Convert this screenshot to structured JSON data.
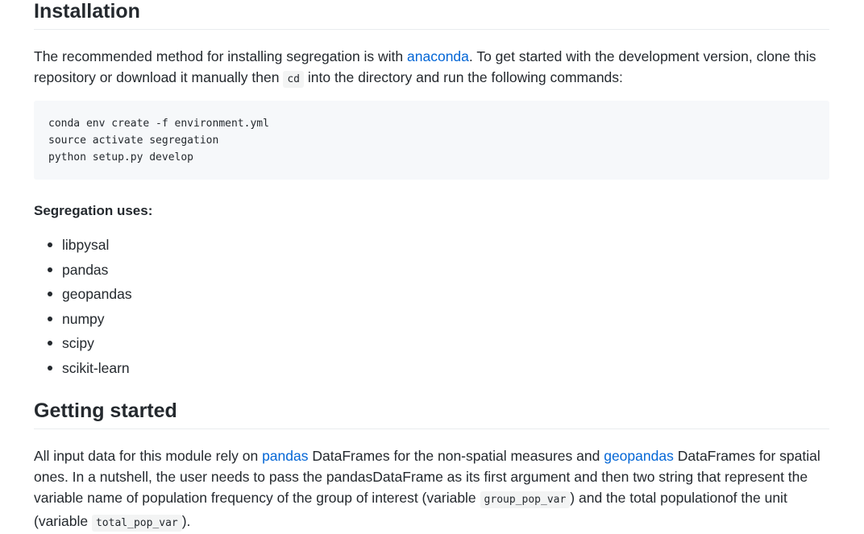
{
  "installation": {
    "heading": "Installation",
    "para": {
      "t1": "The recommended method for installing segregation is with ",
      "link": "anaconda",
      "t2": ". To get started with the development version, clone this repository or download it manually then ",
      "code": "cd",
      "t3": " into the directory and run the following commands:"
    },
    "code_lines": [
      "conda env create -f environment.yml",
      "source activate segregation",
      "python setup.py develop"
    ],
    "uses_label": "Segregation uses:",
    "deps": [
      "libpysal",
      "pandas",
      "geopandas",
      "numpy",
      "scipy",
      "scikit-learn"
    ]
  },
  "getting_started": {
    "heading": "Getting started",
    "para": {
      "t1": "All input data for this module rely on ",
      "link1": "pandas",
      "t2": " DataFrames for the non-spatial measures and ",
      "link2": "geopandas",
      "t3": " DataFrames for spatial ones. In a nutshell, the user needs to pass the pandasDataFrame as its first argument and then two string that represent the variable name of population frequency of the group of interest (variable ",
      "code1": "group_pop_var",
      "t4": ") and the total populationof the unit (variable ",
      "code2": "total_pop_var",
      "t5": ")."
    }
  },
  "colors": {
    "link": "#0366d6",
    "text": "#24292e",
    "code_bg": "#f6f8fa"
  }
}
